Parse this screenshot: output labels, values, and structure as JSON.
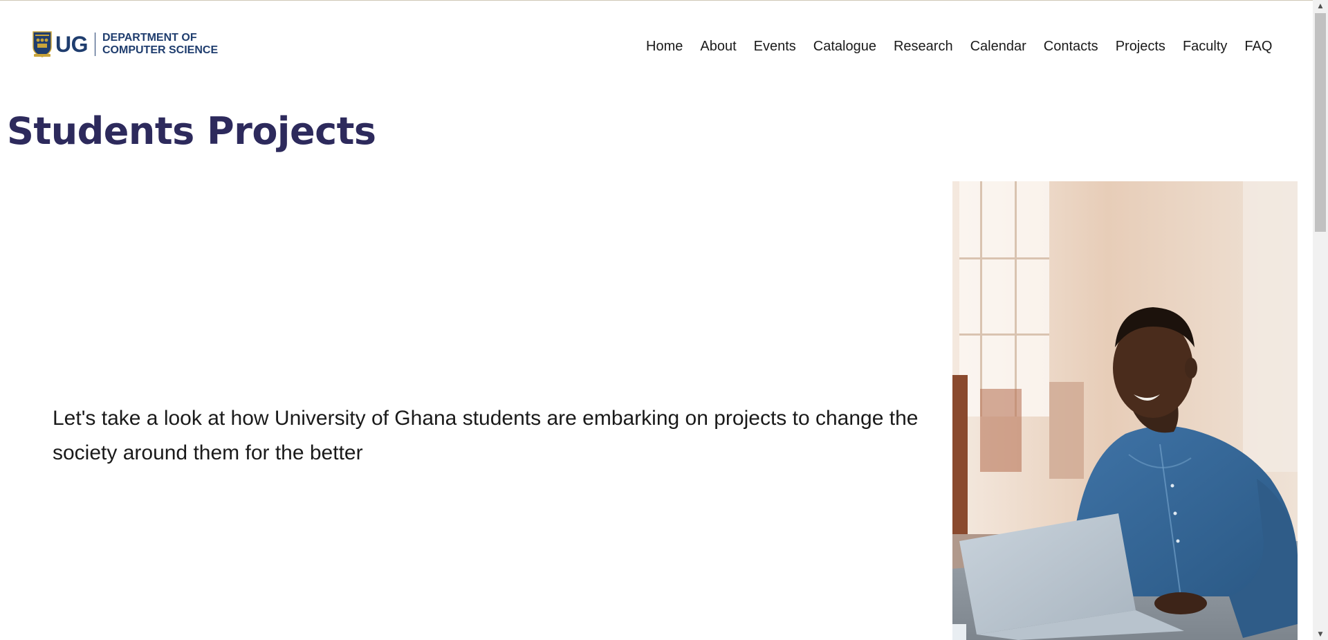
{
  "header": {
    "logo_text": "UG",
    "department_line1": "DEPARTMENT OF",
    "department_line2": "COMPUTER SCIENCE",
    "brand_color": "#1f3d6e"
  },
  "nav": {
    "items": [
      {
        "label": "Home"
      },
      {
        "label": "About"
      },
      {
        "label": "Events"
      },
      {
        "label": "Catalogue"
      },
      {
        "label": "Research"
      },
      {
        "label": "Calendar"
      },
      {
        "label": "Contacts"
      },
      {
        "label": "Projects"
      },
      {
        "label": "Faculty"
      },
      {
        "label": "FAQ"
      }
    ]
  },
  "main": {
    "title": "Students Projects",
    "title_color": "#2d2a5c",
    "intro": "Let's take a look at how University of Ghana students are embarking on projects to change the society around them for the better"
  },
  "hero_image": {
    "subject": "student-with-laptop"
  },
  "scrollbar": {
    "up_icon": "scroll-up-arrow-icon",
    "down_icon": "scroll-down-arrow-icon"
  }
}
